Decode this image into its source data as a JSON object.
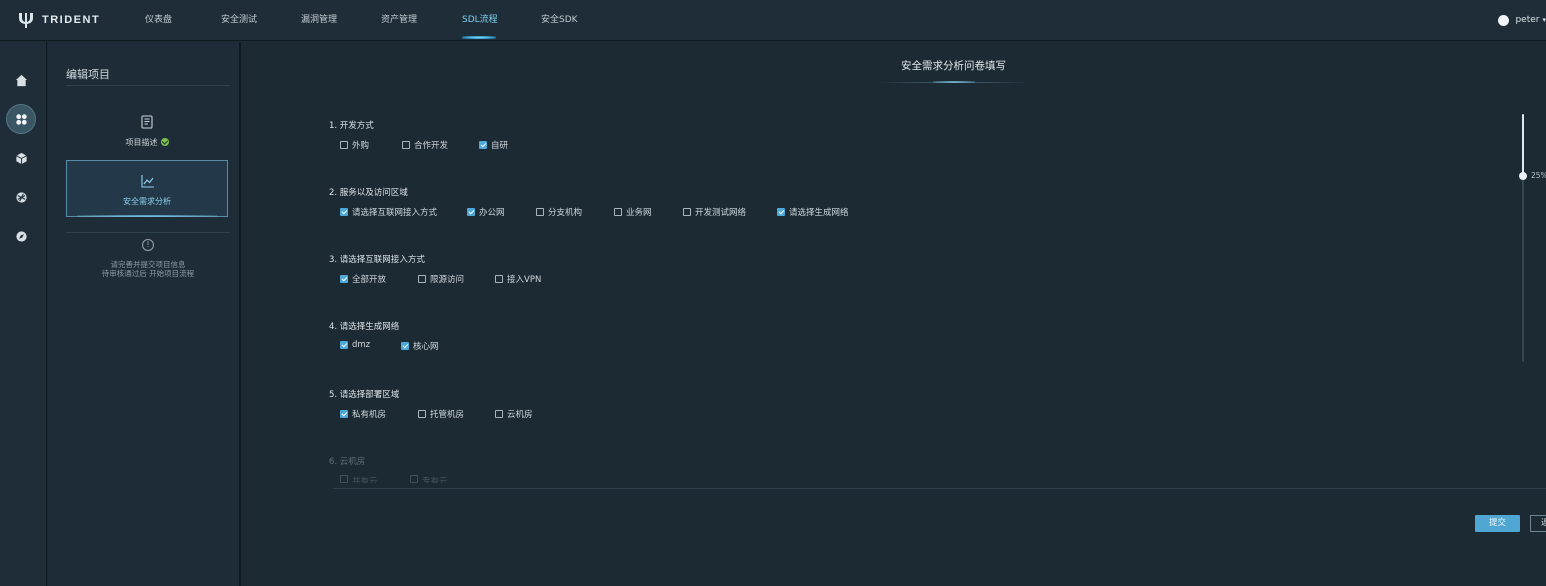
{
  "header": {
    "logo_text": "TRIDENT",
    "nav": [
      {
        "label": "仪表盘"
      },
      {
        "label": "安全测试"
      },
      {
        "label": "漏洞管理"
      },
      {
        "label": "资产管理"
      },
      {
        "label": "SDL流程",
        "active": true
      },
      {
        "label": "安全SDK"
      }
    ],
    "user": {
      "name": "peter"
    }
  },
  "rail": {
    "items": [
      {
        "icon": "home-icon"
      },
      {
        "icon": "apps-grid-icon",
        "active": true
      },
      {
        "icon": "cube-icon"
      },
      {
        "icon": "network-icon"
      },
      {
        "icon": "compass-icon"
      }
    ]
  },
  "panel": {
    "title": "编辑项目",
    "steps": [
      {
        "label": "项目描述",
        "icon": "document-icon",
        "done": true
      },
      {
        "label": "安全需求分析",
        "icon": "line-chart-icon",
        "active": true
      }
    ],
    "notice_lines": [
      "请完善并提交项目信息",
      "待审核通过后 开始项目流程"
    ]
  },
  "main": {
    "title": "安全需求分析问卷填写",
    "questions": [
      {
        "title": "1. 开发方式",
        "options": [
          {
            "label": "外购",
            "checked": false
          },
          {
            "label": "合作开发",
            "checked": false
          },
          {
            "label": "自研",
            "checked": true
          }
        ]
      },
      {
        "title": "2. 服务以及访问区域",
        "options": [
          {
            "label": "请选择互联网接入方式",
            "checked": true
          },
          {
            "label": "办公网",
            "checked": true
          },
          {
            "label": "分支机构",
            "checked": false
          },
          {
            "label": "业务网",
            "checked": false
          },
          {
            "label": "开发测试网络",
            "checked": false
          },
          {
            "label": "请选择生成网络",
            "checked": true
          }
        ]
      },
      {
        "title": "3. 请选择互联网接入方式",
        "options": [
          {
            "label": "全部开放",
            "checked": true
          },
          {
            "label": "限源访问",
            "checked": false
          },
          {
            "label": "接入VPN",
            "checked": false
          }
        ]
      },
      {
        "title": "4. 请选择生成网络",
        "options": [
          {
            "label": "dmz",
            "checked": true
          },
          {
            "label": "核心网",
            "checked": true
          }
        ]
      },
      {
        "title": "5. 请选择部署区域",
        "options": [
          {
            "label": "私有机房",
            "checked": true
          },
          {
            "label": "托管机房",
            "checked": false
          },
          {
            "label": "云机房",
            "checked": false
          }
        ]
      },
      {
        "title": "6. 云机房",
        "options": [
          {
            "label": "共有云",
            "checked": false
          },
          {
            "label": "专有云",
            "checked": false
          }
        ]
      }
    ],
    "progress": {
      "value": 0.25,
      "label": "25%"
    },
    "submit_label": "提交",
    "second_label": "返"
  }
}
